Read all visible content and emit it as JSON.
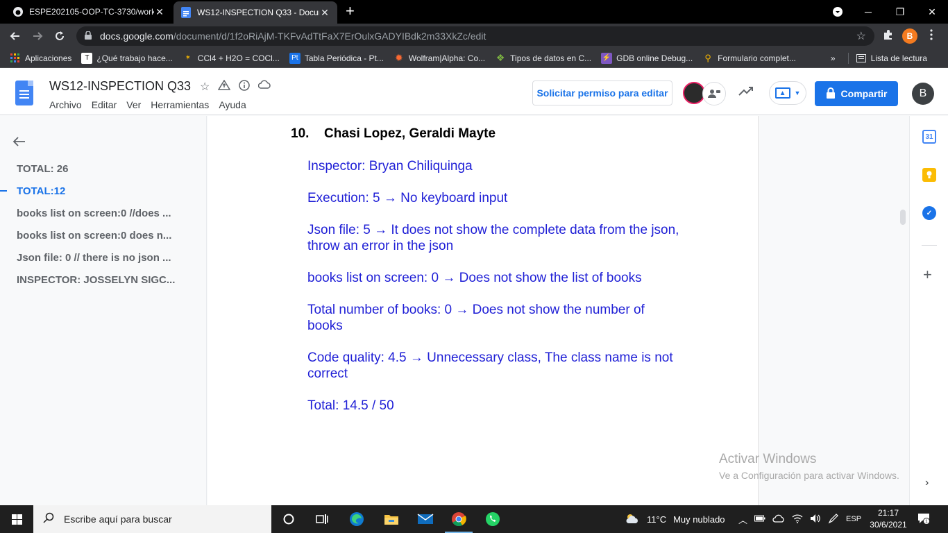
{
  "browser": {
    "tabs": [
      {
        "title": "ESPE202105-OOP-TC-3730/work",
        "close": "✕",
        "active": false
      },
      {
        "title": "WS12-INSPECTION Q33 - Docum",
        "close": "✕",
        "active": true
      }
    ],
    "new_tab": "+",
    "window_controls": {
      "minimize": "─",
      "maximize": "❐",
      "close": "✕"
    },
    "url_host": "docs.google.com",
    "url_path": "/document/d/1f2oRiAjM-TKFvAdTtFaX7ErOulxGADYIBdk2m33XkZc/edit",
    "profile_initial": "B",
    "bookmarks": [
      {
        "label": "Aplicaciones",
        "icon": "apps-grid-icon",
        "color": "#ea4335"
      },
      {
        "label": "¿Qué trabajo hace...",
        "icon": "site-icon",
        "color": "#ffffff"
      },
      {
        "label": "CCl4 + H2O = COCl...",
        "icon": "molecule-icon",
        "color": "#f4b400"
      },
      {
        "label": "Tabla Periódica - Pt...",
        "icon": "pt-icon",
        "color": "#1a73e8"
      },
      {
        "label": "Wolfram|Alpha: Co...",
        "icon": "wolfram-icon",
        "color": "#f96932"
      },
      {
        "label": "Tipos de datos en C...",
        "icon": "leaf-icon",
        "color": "#7cb342"
      },
      {
        "label": "GDB online Debug...",
        "icon": "gdb-icon",
        "color": "#7e57c2"
      },
      {
        "label": "Formulario complet...",
        "icon": "form-icon",
        "color": "#f4b400"
      }
    ],
    "bookmarks_overflow": "»",
    "reading_list": "Lista de lectura"
  },
  "docs": {
    "title": "WS12-INSPECTION Q33",
    "menu": [
      "Archivo",
      "Editar",
      "Ver",
      "Herramientas",
      "Ayuda"
    ],
    "request_edit": "Solicitar permiso para editar",
    "share": "Compartir",
    "account_initial": "B"
  },
  "outline": {
    "items": [
      {
        "label": "TOTAL: 26",
        "selected": false
      },
      {
        "label": "TOTAL:12",
        "selected": true
      },
      {
        "label": "books list on screen:0 //does ...",
        "selected": false
      },
      {
        "label": "books list on screen:0 does n...",
        "selected": false
      },
      {
        "label": "Json file: 0 // there is no json ...",
        "selected": false
      },
      {
        "label": "INSPECTOR: JOSSELYN SIGC...",
        "selected": false
      }
    ]
  },
  "document": {
    "heading_number": "10.",
    "heading_text": "Chasi Lopez, Geraldi Mayte",
    "paragraphs": [
      "Inspector: Bryan Chiliquinga",
      "Execution: 5 → No keyboard input",
      "Json file: 5 → It does not show the complete data from the json, throw an error in the json",
      "books list on screen: 0 → Does not show the list of books",
      "Total number of books: 0 → Does not show the number of books",
      "Code quality: 4.5 → Unnecessary class, The class name is not correct",
      "Total: 14.5 / 50"
    ],
    "text_color": "#1f1fd6"
  },
  "watermark": {
    "line1": "Activar Windows",
    "line2": "Ve a Configuración para activar Windows."
  },
  "taskbar": {
    "search_placeholder": "Escribe aquí para buscar",
    "weather_temp": "11°C",
    "weather_desc": "Muy nublado",
    "language": "ESP",
    "time": "21:17",
    "date": "30/6/2021"
  }
}
